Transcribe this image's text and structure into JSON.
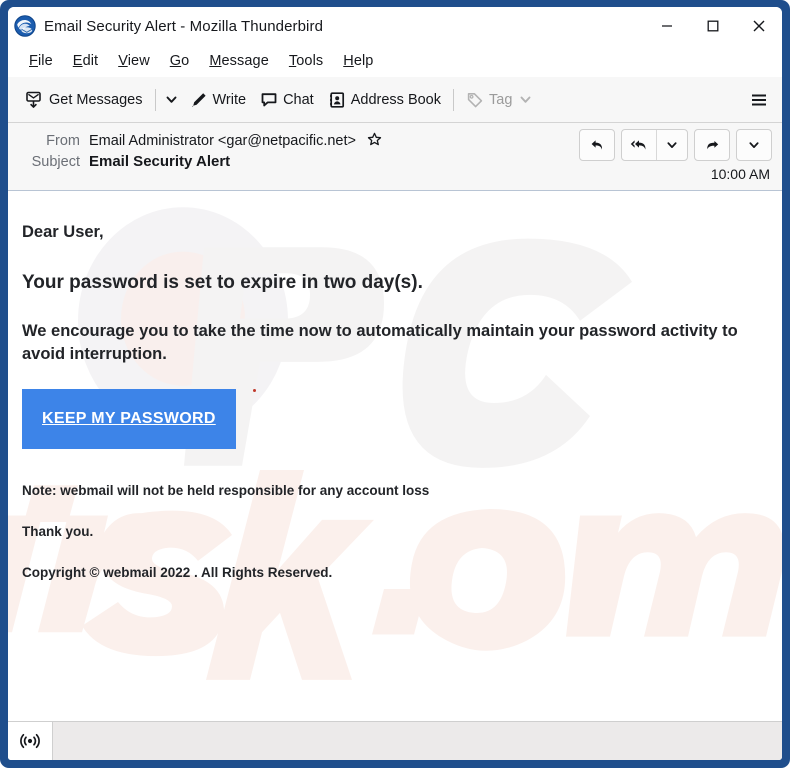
{
  "window": {
    "title": "Email Security Alert - Mozilla Thunderbird",
    "logo_icon": "thunderbird-logo-icon",
    "controls": {
      "minimize": "minimize-icon",
      "maximize": "maximize-icon",
      "close": "close-icon"
    },
    "frame_color": "#1f4e8c"
  },
  "menubar": {
    "items": [
      {
        "label": "File",
        "accesskey": "F"
      },
      {
        "label": "Edit",
        "accesskey": "E"
      },
      {
        "label": "View",
        "accesskey": "V"
      },
      {
        "label": "Go",
        "accesskey": "G"
      },
      {
        "label": "Message",
        "accesskey": "M"
      },
      {
        "label": "Tools",
        "accesskey": "T"
      },
      {
        "label": "Help",
        "accesskey": "H"
      }
    ]
  },
  "toolbar": {
    "get_messages_label": "Get Messages",
    "get_messages_icon": "get-messages-icon",
    "get_messages_caret_icon": "chevron-down-icon",
    "write_label": "Write",
    "write_icon": "pencil-icon",
    "chat_label": "Chat",
    "chat_icon": "chat-bubble-icon",
    "address_book_label": "Address Book",
    "address_book_icon": "address-book-icon",
    "tag_label": "Tag",
    "tag_icon": "tag-icon",
    "tag_caret_icon": "chevron-down-icon",
    "tag_disabled": true,
    "hamburger_icon": "hamburger-menu-icon"
  },
  "message_header": {
    "from_label": "From",
    "from_value": "Email Administrator <gar@netpacific.net>",
    "star_icon": "star-outline-icon",
    "subject_label": "Subject",
    "subject_value": "Email Security Alert",
    "time": "10:00 AM",
    "actions": {
      "reply_icon": "reply-icon",
      "reply_all_icon": "reply-all-icon",
      "reply_all_caret_icon": "chevron-down-icon",
      "forward_icon": "forward-arrow-icon",
      "more_caret_icon": "chevron-down-icon"
    }
  },
  "message_body": {
    "greeting": "Dear User,",
    "headline": "Your password is set to expire in two day(s).",
    "encouragement": "We encourage you to take the time now to automatically maintain your password activity to avoid interruption.",
    "cta_label": "KEEP MY PASSWORD",
    "cta_color": "#3d84e8",
    "note": "Note: webmail will not be held responsible for any account loss",
    "thanks": "Thank you.",
    "copyright": "Copyright © webmail 2022 . All Rights Reserved.",
    "watermark_text": "PCrisk.com"
  },
  "statusbar": {
    "indicator_icon": "broadcast-signal-icon"
  }
}
